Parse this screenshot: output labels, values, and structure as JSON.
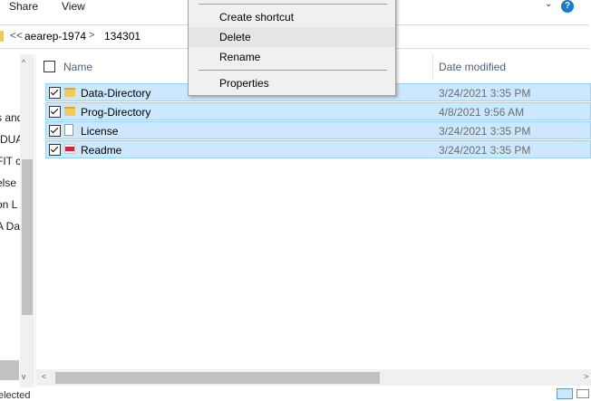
{
  "ribbon": {
    "tabs": [
      "Share",
      "View"
    ],
    "expand_icon": "chevron-down-icon",
    "help_label": "?"
  },
  "address": {
    "overflow_label": "<<",
    "crumbs": [
      "aearep-1974",
      "134301"
    ],
    "separator": ">"
  },
  "nav": {
    "items": [
      "s and",
      "-DUA",
      "FIT c",
      "else",
      "on L",
      "A Da"
    ],
    "scroll_up": "^",
    "scroll_down": "v"
  },
  "columns": {
    "name": "Name",
    "date_modified": "Date modified"
  },
  "files": [
    {
      "name": "Data-Directory",
      "date": "3/24/2021 3:35 PM",
      "type": "folder",
      "checked": true
    },
    {
      "name": "Prog-Directory",
      "date": "4/8/2021 9:56 AM",
      "type": "folder",
      "checked": true
    },
    {
      "name": "License",
      "date": "3/24/2021 3:35 PM",
      "type": "document",
      "checked": true
    },
    {
      "name": "Readme",
      "date": "3/24/2021 3:35 PM",
      "type": "pdf",
      "checked": true
    }
  ],
  "context_menu": {
    "items": [
      "Create shortcut",
      "Delete",
      "Rename",
      "Properties"
    ],
    "hovered": "Delete"
  },
  "scrollbar": {
    "left": "<",
    "right": ">"
  },
  "status": {
    "text": "elected"
  },
  "colors": {
    "selection_bg": "#cce8ff",
    "selection_border": "#99d1ff",
    "header_text": "#4c607a",
    "menu_bg": "#f0f0f0"
  }
}
